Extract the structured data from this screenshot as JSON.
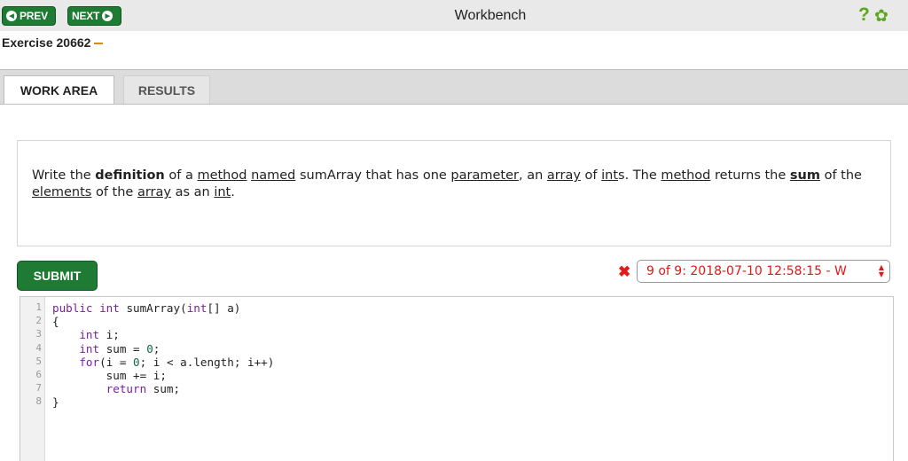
{
  "topbar": {
    "prev_label": "PREV",
    "next_label": "NEXT",
    "title": "Workbench",
    "help_glyph": "?",
    "settings_glyph": "✿"
  },
  "exercise": {
    "label": "Exercise 20662"
  },
  "tabs": [
    {
      "label": "WORK AREA",
      "active": true
    },
    {
      "label": "RESULTS",
      "active": false
    }
  ],
  "prompt": {
    "parts": [
      "Write the ",
      "definition",
      " of a ",
      "method",
      " ",
      "named",
      " sumArray that has one ",
      "parameter",
      ", an ",
      "array",
      " of ",
      "int",
      "s. The ",
      "method",
      " returns the ",
      "sum",
      " of the ",
      "elements",
      " of the ",
      "array",
      " as an ",
      "int",
      "."
    ]
  },
  "submit_label": "SUBMIT",
  "attempt": {
    "text": "9 of 9: 2018-07-10 12:58:15 - W",
    "status": "wrong"
  },
  "editor": {
    "line_numbers": [
      "1",
      "2",
      "3",
      "4",
      "5",
      "6",
      "7",
      "8"
    ],
    "lines": [
      "public int sumArray(int[] a)",
      "{",
      "    int i;",
      "    int sum = 0;",
      "    for(i = 0; i < a.length; i++)",
      "        sum += i;",
      "        return sum;",
      "}"
    ]
  },
  "colors": {
    "accent_green": "#1f7a34",
    "icon_green": "#5ca61a",
    "error_red": "#e01818",
    "exercise_dash": "#d98a14"
  },
  "icons": [
    "chevron-left-icon",
    "chevron-right-icon",
    "help-icon",
    "gear-icon",
    "close-icon",
    "sort-arrows-icon"
  ]
}
